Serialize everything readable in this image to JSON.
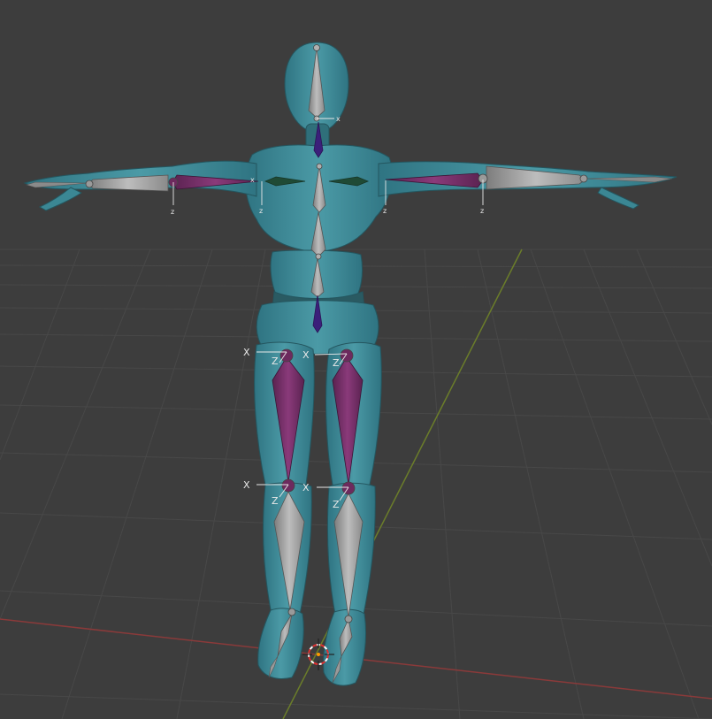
{
  "viewport": {
    "background": "#3d3d3d",
    "grid_color": "#474747",
    "x_axis_color": "#8a3a3a",
    "y_axis_color": "#6b7d2a"
  },
  "mesh": {
    "color": "#3f8f9c",
    "shadow": "#2e6f7a",
    "highlight": "#5aa9b4"
  },
  "bones": {
    "deform_color": "#9a9a9a",
    "selected_color": "#6d2a5e",
    "ik_color": "#3b1f7a",
    "joint_color": "#b0b0b0"
  },
  "axis_labels": {
    "x": "X",
    "z": "Z",
    "x_small": "x",
    "z_small": "z"
  },
  "cursor": {
    "name": "3d-cursor",
    "color": "#e03030"
  }
}
